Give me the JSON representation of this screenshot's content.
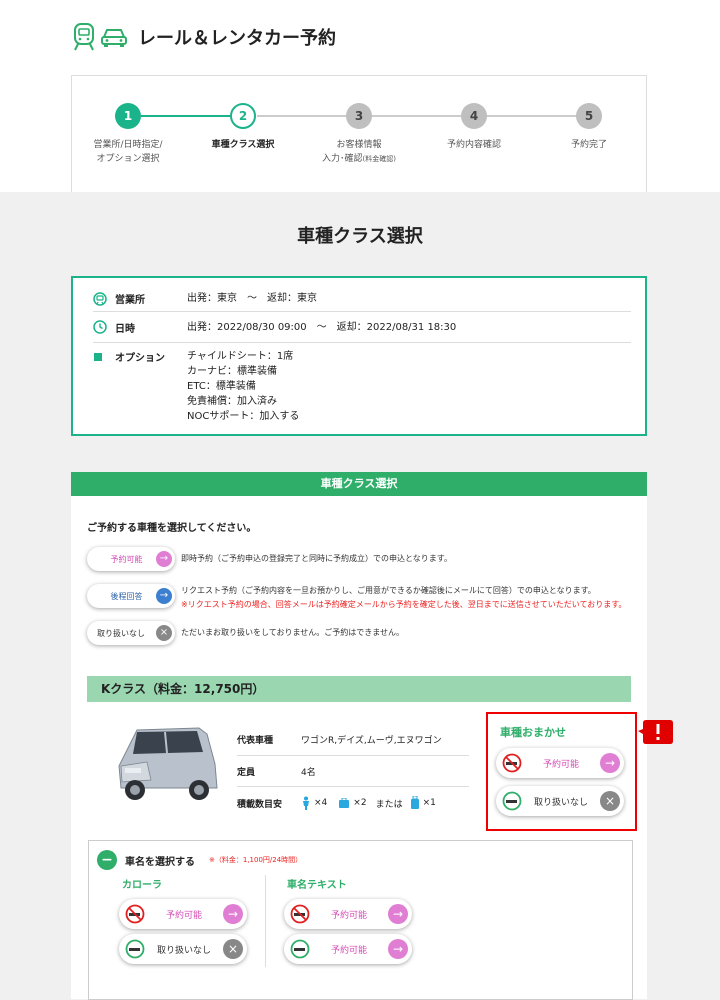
{
  "app": {
    "title": "レール＆レンタカー予約"
  },
  "steps": [
    {
      "num": "1",
      "label": "営業所/日時指定/\nオプション選択",
      "state": "done"
    },
    {
      "num": "2",
      "label": "車種クラス選択",
      "state": "current"
    },
    {
      "num": "3",
      "label": "お客様情報\n入力･確認",
      "note": "(料金確認)",
      "state": "todo"
    },
    {
      "num": "4",
      "label": "予約内容確認",
      "state": "todo"
    },
    {
      "num": "5",
      "label": "予約完了",
      "state": "todo"
    }
  ],
  "page": {
    "title": "車種クラス選択"
  },
  "summary": {
    "office": {
      "label": "営業所",
      "value": "出発：東京　～　返却：東京"
    },
    "datetime": {
      "label": "日時",
      "value": "出発：2022/08/30 09:00　～　返却：2022/08/31 18:30"
    },
    "option": {
      "label": "オプション",
      "lines": [
        "チャイルドシート：1席",
        "カーナビ：標準装備",
        "ETC：標準装備",
        "免責補償：加入済み",
        "NOCサポート：加入する"
      ]
    }
  },
  "panel": {
    "header": "車種クラス選択",
    "intro": "ご予約する車種を選択してください。",
    "legend": [
      {
        "pill": "予約可能",
        "text": "即時予約（ご予約申込の登録完了と同時に予約成立）での申込となります。"
      },
      {
        "pill": "後程回答",
        "text": "リクエスト予約（ご予約内容を一旦お預かりし、ご用意ができるか確認後にメールにて回答）での申込となります。",
        "note": "※リクエスト予約の場合、回答メールは予約確定メールから予約を確定した後、翌日までに送信させていただいております。"
      },
      {
        "pill": "取り扱いなし",
        "text": "ただいまお取り扱いをしておりません。ご予約はできません。"
      }
    ]
  },
  "kclass": {
    "title": "Kクラス（料金：12,750円）",
    "specs": {
      "model_label": "代表車種",
      "model_value": "ワゴンR,デイズ,ムーヴ,エヌワゴン",
      "capacity_label": "定員",
      "capacity_value": "4名",
      "luggage_label": "積載数目安",
      "luggage_large": "×4",
      "luggage_small": "×2",
      "or_text": "または",
      "luggage_suitcase": "×1"
    },
    "omakase": {
      "title": "車種おまかせ",
      "smoking": "予約可能",
      "nonsmoking": "取り扱いなし"
    }
  },
  "car_select": {
    "title": "車名を選択する",
    "note": "※（料金：1,100円/24時間）",
    "columns": [
      {
        "name": "カローラ",
        "smoking": "予約可能",
        "nonsmoking": "取り扱いなし"
      },
      {
        "name": "車名テキスト",
        "smoking": "予約可能",
        "nonsmoking": "予約可能"
      }
    ]
  },
  "colors": {
    "green": "#1bb48a",
    "panel_green": "#2fae6a",
    "pink": "#e07ed4",
    "alert_red": "#e00000"
  }
}
